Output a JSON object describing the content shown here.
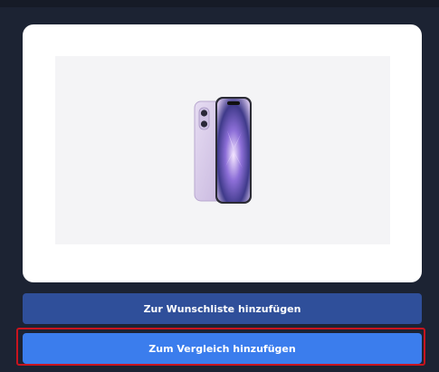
{
  "product": {
    "image_icon": "iphone-product-image",
    "image_bg": "#f4f4f6"
  },
  "actions": {
    "wishlist_label": "Zur Wunschliste hinzufügen",
    "compare_label": "Zum Vergleich hinzufügen"
  },
  "colors": {
    "page_bg": "#1c2333",
    "wishlist_button": "#2f4f9a",
    "compare_button": "#3b7ded",
    "highlight": "#c8141e"
  }
}
